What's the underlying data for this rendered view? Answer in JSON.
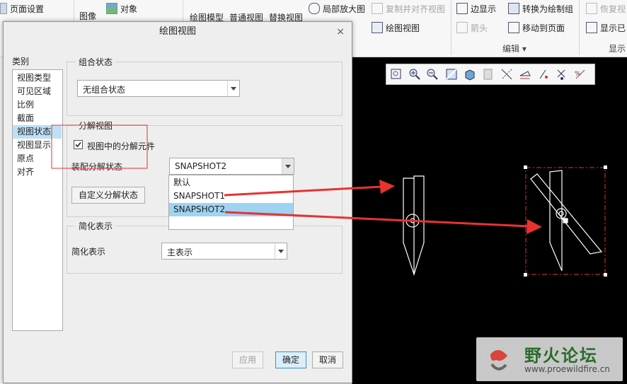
{
  "ribbon": {
    "page_setup": "页面设置",
    "image": "图像",
    "object": "对象",
    "drawing_model": "绘图模型",
    "general_view": "普通视图",
    "replace_view": "替换视图",
    "partial_zoom": "局部放大图",
    "copy_align_view": "复制并对齐视图",
    "drawing_view": "绘图视图",
    "edge_display": "边显示",
    "convert_to_draw_group": "转换为绘制组",
    "arrow": "箭头",
    "move_to_page": "移动到页面",
    "restore": "恢复视",
    "show_existing": "显示已",
    "edit_group": "编辑",
    "display_group": "显示"
  },
  "dialog": {
    "title": "绘图视图",
    "close": "×",
    "category_label": "类别",
    "categories": [
      "视图类型",
      "可见区域",
      "比例",
      "截面",
      "视图状态",
      "视图显示",
      "原点",
      "对齐"
    ],
    "selected_category": "视图状态",
    "combo_state": {
      "group_title": "组合状态",
      "value": "无组合状态"
    },
    "explode_view": {
      "group_title": "分解视图",
      "checkbox_label": "视图中的分解元件",
      "checked": true,
      "assembly_explode_label": "装配分解状态",
      "assembly_explode_value": "SNAPSHOT2",
      "options": [
        "默认",
        "SNAPSHOT1",
        "SNAPSHOT2"
      ],
      "selected_option": "SNAPSHOT2",
      "custom_button": "自定义分解状态"
    },
    "simplified": {
      "group_title": "简化表示",
      "label": "简化表示",
      "value": "主表示"
    },
    "buttons": {
      "apply": "应用",
      "ok": "确定",
      "cancel": "取消"
    }
  },
  "watermark": {
    "title": "野火论坛",
    "url": "www.proewildfire.cn"
  },
  "colors": {
    "annotation_red": "#e8332f",
    "selection_blue": "#bde0f7",
    "canvas_bg": "#000000",
    "drawing_lines": "#ffffff"
  }
}
